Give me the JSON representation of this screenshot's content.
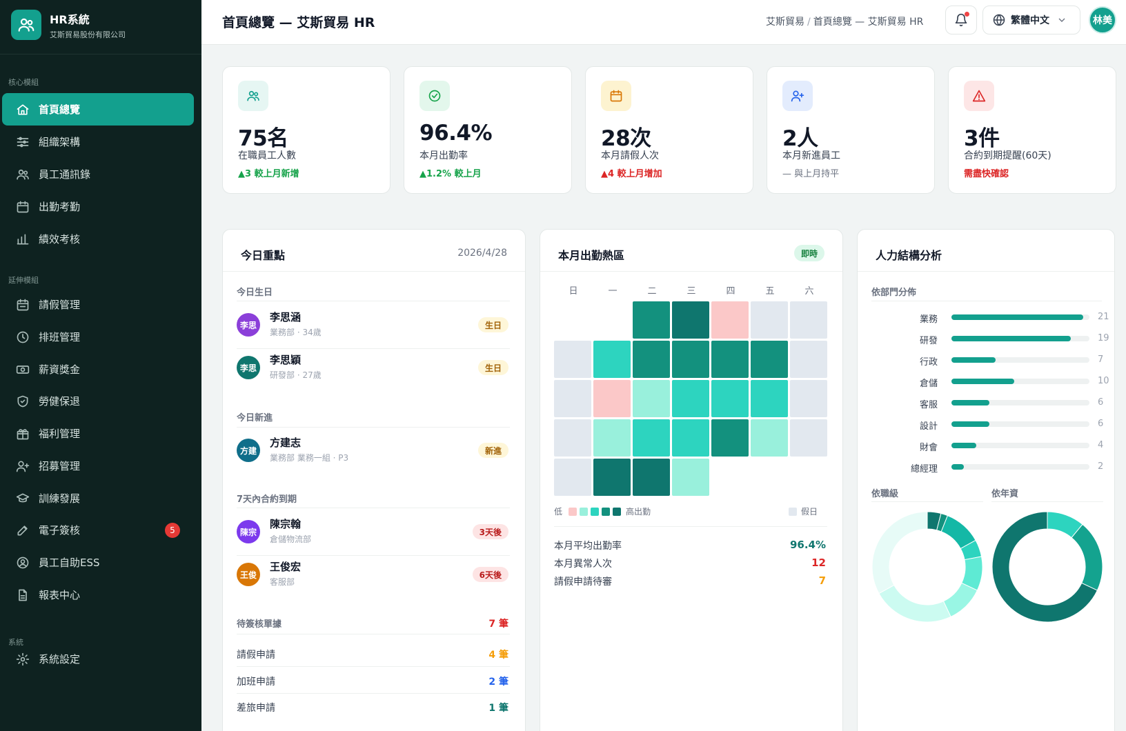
{
  "brand": {
    "title": "HR系統",
    "subtitle": "艾斯貿易股份有限公司"
  },
  "sidebar": {
    "sections": [
      "核心模組",
      "延伸模組",
      "系統"
    ],
    "items": [
      {
        "label": "首頁總覽",
        "icon": "home-icon",
        "active": true
      },
      {
        "label": "組織架構",
        "icon": "org-chart-icon"
      },
      {
        "label": "員工通訊錄",
        "icon": "users-icon"
      },
      {
        "label": "出勤考勤",
        "icon": "calendar-icon"
      },
      {
        "label": "績效考核",
        "icon": "bar-chart-icon"
      },
      {
        "label": "請假管理",
        "icon": "calendar-leave-icon"
      },
      {
        "label": "排班管理",
        "icon": "clock-icon"
      },
      {
        "label": "薪資獎金",
        "icon": "money-icon"
      },
      {
        "label": "勞健保退",
        "icon": "shield-icon"
      },
      {
        "label": "福利管理",
        "icon": "gift-icon"
      },
      {
        "label": "招募管理",
        "icon": "user-plus-icon"
      },
      {
        "label": "訓練發展",
        "icon": "graduation-cap-icon"
      },
      {
        "label": "電子簽核",
        "icon": "pen-icon",
        "badge": "5"
      },
      {
        "label": "員工自助ESS",
        "icon": "user-circle-icon"
      },
      {
        "label": "報表中心",
        "icon": "document-icon"
      },
      {
        "label": "系統設定",
        "icon": "gear-icon"
      }
    ]
  },
  "header": {
    "title": "首頁總覽 — 艾斯貿易 HR",
    "breadcrumb": [
      "艾斯貿易",
      "首頁總覽 — 艾斯貿易 HR"
    ],
    "language": "繁體中文",
    "user_initials": "林美"
  },
  "stats": [
    {
      "value": "75名",
      "label": "在職員工人數",
      "trend": "▲3 較上月新增",
      "trend_color": "#16a34a",
      "icon": "users-icon",
      "icon_bg": "#e6f6f3",
      "icon_color": "#13a08e"
    },
    {
      "value": "96.4%",
      "label": "本月出勤率",
      "trend": "▲1.2% 較上月",
      "trend_color": "#16a34a",
      "icon": "check-circle-icon",
      "icon_bg": "#e3f7ec",
      "icon_color": "#16a34a"
    },
    {
      "value": "28次",
      "label": "本月請假人次",
      "trend": "▲4 較上月增加",
      "trend_color": "#dc2626",
      "icon": "calendar-icon",
      "icon_bg": "#fdf3d0",
      "icon_color": "#d97706"
    },
    {
      "value": "2人",
      "label": "本月新進員工",
      "trend": "— 與上月持平",
      "trend_color": "#6b7280",
      "icon": "user-plus-icon",
      "icon_bg": "#e3ecfd",
      "icon_color": "#2563eb"
    },
    {
      "value": "3件",
      "label": "合約到期提醒(60天)",
      "trend": "需盡快確認",
      "trend_color": "#dc2626",
      "icon": "alert-triangle-icon",
      "icon_bg": "#fde6e6",
      "icon_color": "#dc2626"
    }
  ],
  "today": {
    "title": "今日重點",
    "date": "2026/4/28",
    "birthday_label": "今日生日",
    "birthdays": [
      {
        "initials": "李思",
        "name": "李思涵",
        "meta": "業務部 · 34歲",
        "tag": "生日",
        "color": "#8b3fd9"
      },
      {
        "initials": "李思",
        "name": "李思穎",
        "meta": "研發部 · 27歲",
        "tag": "生日",
        "color": "#0f766e"
      }
    ],
    "newhire_label": "今日新進",
    "newhires": [
      {
        "initials": "方建",
        "name": "方建志",
        "meta": "業務部 業務一組 · P3",
        "tag": "新進",
        "color": "#0f6e8a"
      }
    ],
    "contract_label": "7天內合約到期",
    "contracts": [
      {
        "initials": "陳宗",
        "name": "陳宗翰",
        "meta": "倉儲物流部",
        "tag": "3天後",
        "color": "#7c3aed"
      },
      {
        "initials": "王俊",
        "name": "王俊宏",
        "meta": "客服部",
        "tag": "6天後",
        "color": "#d97706"
      }
    ],
    "pending_label": "待簽核單據",
    "pending_total": "7 筆",
    "pending": [
      {
        "label": "請假申請",
        "value": "4 筆",
        "color": "#f59e0b"
      },
      {
        "label": "加班申請",
        "value": "2 筆",
        "color": "#2563eb"
      },
      {
        "label": "差旅申請",
        "value": "1 筆",
        "color": "#0f766e"
      }
    ]
  },
  "heatmap": {
    "title": "本月出勤熱區",
    "badge": "即時",
    "weekdays": [
      "日",
      "一",
      "二",
      "三",
      "四",
      "五",
      "六"
    ],
    "legend": {
      "low": "低",
      "high": "高出勤",
      "holiday": "假日"
    },
    "legend_colors": [
      "#fbc8c8",
      "#99f0dc",
      "#2dd4bf",
      "#13917e",
      "#0f766e"
    ],
    "cells": [
      [
        null,
        null,
        3,
        4,
        "r",
        "h",
        "h"
      ],
      [
        "h",
        2,
        3,
        3,
        3,
        3,
        "h"
      ],
      [
        "h",
        "r",
        1,
        2,
        2,
        2,
        "h"
      ],
      [
        "h",
        1,
        2,
        2,
        3,
        1,
        "h"
      ],
      [
        "h",
        4,
        4,
        1,
        null,
        null,
        null
      ]
    ],
    "summary": [
      {
        "label": "本月平均出勤率",
        "value": "96.4%",
        "color": "#0f766e"
      },
      {
        "label": "本月異常人次",
        "value": "12",
        "color": "#dc2626"
      },
      {
        "label": "請假申請待審",
        "value": "7",
        "color": "#f59e0b"
      }
    ]
  },
  "workforce": {
    "title": "人力結構分析",
    "dept_label": "依部門分佈",
    "departments": [
      {
        "name": "業務",
        "value": 21
      },
      {
        "name": "研發",
        "value": 19
      },
      {
        "name": "行政",
        "value": 7
      },
      {
        "name": "倉儲",
        "value": 10
      },
      {
        "name": "客服",
        "value": 6
      },
      {
        "name": "設計",
        "value": 6
      },
      {
        "name": "財會",
        "value": 4
      },
      {
        "name": "總經理",
        "value": 2
      }
    ],
    "dept_max": 22,
    "grade_label": "依職級",
    "tenure_label": "依年資",
    "grade_slices": [
      {
        "value": 4,
        "color": "#0f766e"
      },
      {
        "value": 2,
        "color": "#13917e"
      },
      {
        "value": 11,
        "color": "#14b8a6"
      },
      {
        "value": 5,
        "color": "#2dd4bf"
      },
      {
        "value": 10,
        "color": "#5eead4"
      },
      {
        "value": 11,
        "color": "#99f6e4"
      },
      {
        "value": 24,
        "color": "#ccfbf1"
      },
      {
        "value": 33,
        "color": "#e7fbf7"
      }
    ],
    "tenure_slices": [
      {
        "value": 11,
        "color": "#2dd4bf"
      },
      {
        "value": 21,
        "color": "#14a38f"
      },
      {
        "value": 68,
        "color": "#0f766e"
      }
    ]
  }
}
